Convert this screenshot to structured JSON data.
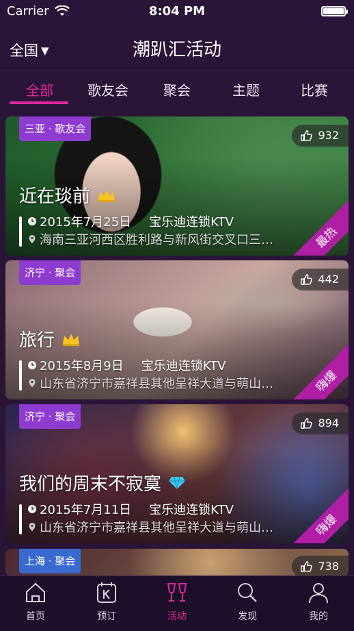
{
  "status_bar": {
    "carrier": "Carrier",
    "time": "8:04 PM"
  },
  "nav": {
    "region": "全国",
    "title": "潮趴汇活动"
  },
  "tabs": [
    {
      "label": "全部",
      "active": true
    },
    {
      "label": "歌友会",
      "active": false
    },
    {
      "label": "聚会",
      "active": false
    },
    {
      "label": "主题",
      "active": false
    },
    {
      "label": "比赛",
      "active": false
    }
  ],
  "cards": [
    {
      "city_tag": "三亚 · 歌友会",
      "likes": "932",
      "title": "近在琰前",
      "badge_icon": "crown-icon",
      "date": "2015年7月25日",
      "venue": "宝乐迪连锁KTV",
      "address": "海南三亚河西区胜利路与新风街交叉口三…",
      "ribbon": "最热",
      "bg_colors": [
        "#1e5a2a",
        "#3f8a3e"
      ]
    },
    {
      "city_tag": "济宁 · 聚会",
      "likes": "442",
      "title": "旅行",
      "badge_icon": "crown-icon",
      "date": "2015年8月9日",
      "venue": "宝乐迪连锁KTV",
      "address": "山东省济宁市嘉祥县其他呈祥大道与萌山…",
      "ribbon": "嗨爆",
      "bg_colors": [
        "#8a6a72",
        "#c9a8a0"
      ]
    },
    {
      "city_tag": "济宁 · 聚会",
      "likes": "894",
      "title": "我们的周末不寂寞",
      "badge_icon": "diamond-icon",
      "date": "2015年7月11日",
      "venue": "宝乐迪连锁KTV",
      "address": "山东省济宁市嘉祥县其他呈祥大道与萌山…",
      "ribbon": "嗨爆",
      "bg_colors": [
        "#2a2550",
        "#6a3a3a"
      ]
    },
    {
      "city_tag": "上海 · 聚会",
      "likes": "738",
      "bg_colors": [
        "#4a2a30",
        "#8a6a50"
      ]
    }
  ],
  "tab_bar": [
    {
      "label": "首页",
      "icon": "home-icon",
      "active": false
    },
    {
      "label": "预订",
      "icon": "ktv-booking-icon",
      "active": false
    },
    {
      "label": "活动",
      "icon": "cheers-icon",
      "active": true
    },
    {
      "label": "发现",
      "icon": "search-icon",
      "active": false
    },
    {
      "label": "我的",
      "icon": "profile-icon",
      "active": false
    }
  ],
  "colors": {
    "accent": "#e0279a",
    "background": "#2a1538",
    "tag": "#8e3bd0",
    "ribbon": "#b01ea5"
  }
}
